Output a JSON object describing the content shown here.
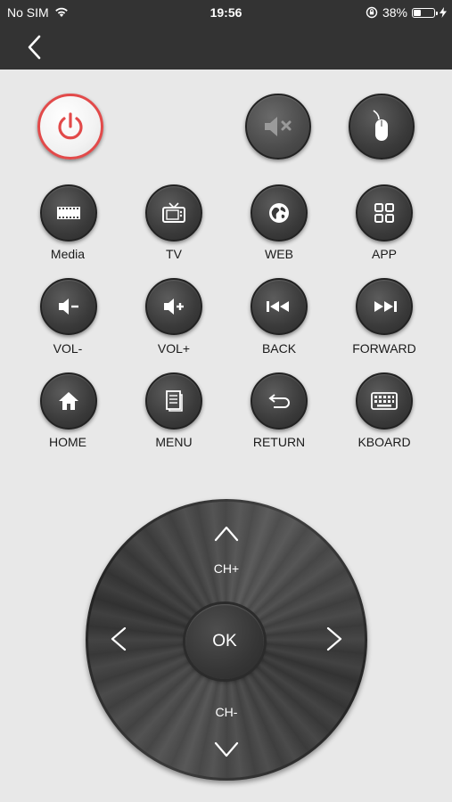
{
  "status_bar": {
    "carrier": "No SIM",
    "time": "19:56",
    "battery_percent": "38%",
    "battery_level": 0.38
  },
  "nav": {
    "back_icon": "chevron-left-icon"
  },
  "top_buttons": [
    {
      "name": "power",
      "icon": "power-icon",
      "color": "#e24a4a"
    },
    {
      "name": "mute",
      "icon": "mute-icon"
    },
    {
      "name": "mouse",
      "icon": "mouse-icon"
    }
  ],
  "grid": {
    "row1": [
      {
        "label": "Media",
        "icon": "film-icon"
      },
      {
        "label": "TV",
        "icon": "tv-icon"
      },
      {
        "label": "WEB",
        "icon": "globe-icon"
      },
      {
        "label": "APP",
        "icon": "apps-grid-icon"
      }
    ],
    "row2": [
      {
        "label": "VOL-",
        "icon": "volume-down-icon"
      },
      {
        "label": "VOL+",
        "icon": "volume-up-icon"
      },
      {
        "label": "BACK",
        "icon": "rewind-icon"
      },
      {
        "label": "FORWARD",
        "icon": "fast-forward-icon"
      }
    ],
    "row3": [
      {
        "label": "HOME",
        "icon": "home-icon"
      },
      {
        "label": "MENU",
        "icon": "menu-doc-icon"
      },
      {
        "label": "RETURN",
        "icon": "return-arrow-icon"
      },
      {
        "label": "KBOARD",
        "icon": "keyboard-icon"
      }
    ]
  },
  "dpad": {
    "ok_label": "OK",
    "ch_up_label": "CH+",
    "ch_down_label": "CH-"
  }
}
